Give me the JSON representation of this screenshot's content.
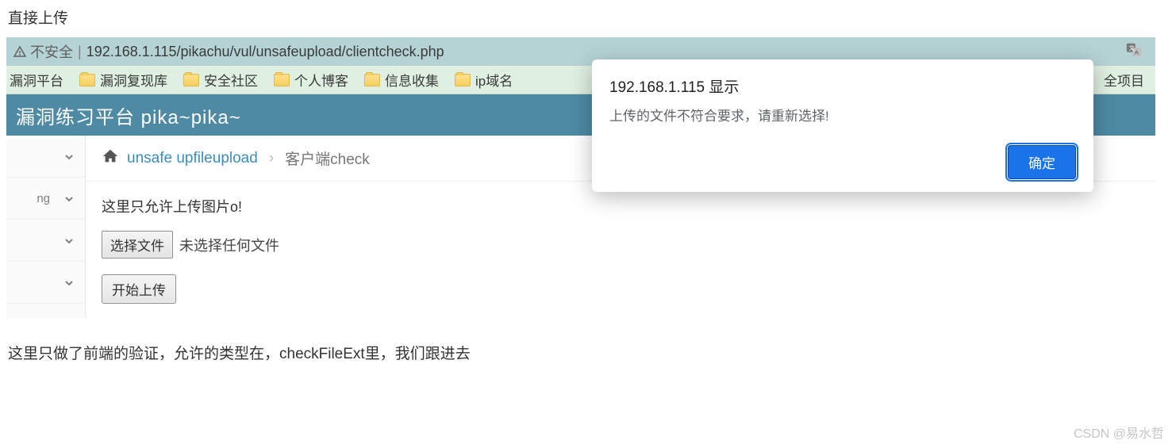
{
  "page": {
    "top_text": "直接上传",
    "bottom_text": "这里只做了前端的验证，允许的类型在，checkFileExt里，我们跟进去",
    "watermark": "CSDN @易水哲"
  },
  "address_bar": {
    "insecure": "不安全",
    "url": "192.168.1.115/pikachu/vul/unsafeupload/clientcheck.php"
  },
  "bookmarks": {
    "items": [
      {
        "label": "漏洞平台"
      },
      {
        "label": "漏洞复现库"
      },
      {
        "label": "安全社区"
      },
      {
        "label": "个人博客"
      },
      {
        "label": "信息收集"
      },
      {
        "label": "ip域名"
      }
    ],
    "right_label": "全项目"
  },
  "header": {
    "title": "漏洞练习平台 pika~pika~"
  },
  "sidebar": {
    "items": [
      {
        "label": ""
      },
      {
        "label": "ng"
      },
      {
        "label": ""
      },
      {
        "label": ""
      }
    ]
  },
  "breadcrumb": {
    "link": "unsafe upfileupload",
    "current": "客户端check",
    "sep": "›"
  },
  "main": {
    "notice": "这里只允许上传图片o!",
    "choose_file_label": "选择文件",
    "no_file_text": "未选择任何文件",
    "upload_button": "开始上传"
  },
  "alert": {
    "title": "192.168.1.115 显示",
    "message": "上传的文件不符合要求，请重新选择!",
    "ok": "确定"
  }
}
